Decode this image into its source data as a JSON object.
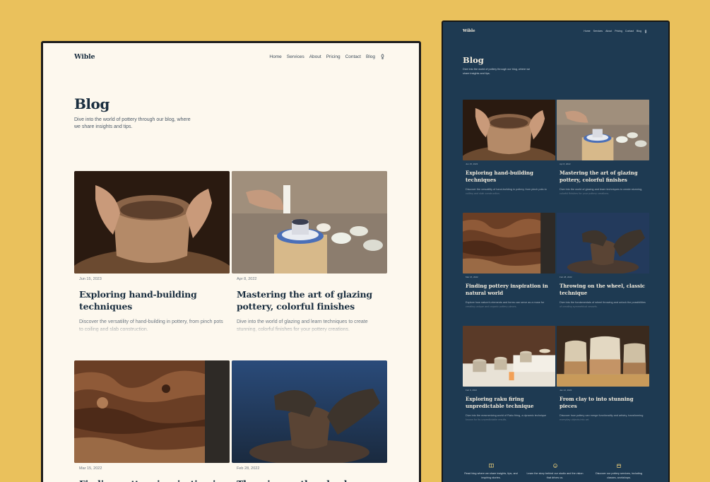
{
  "brand": "Wible",
  "nav": [
    "Home",
    "Services",
    "About",
    "Pricing",
    "Contact",
    "Blog"
  ],
  "hero": {
    "title": "Blog",
    "subtitle": "Dive into the world of pottery through our blog, where we share insights and tips."
  },
  "posts": [
    {
      "date": "Jun 15, 2023",
      "title": "Exploring hand-building techniques",
      "excerpt": "Discover the versatility of hand-building in pottery, from pinch pots to coiling and slab construction.",
      "image": "hands-shaping-pot"
    },
    {
      "date": "Apr 8, 2022",
      "title": "Mastering the art of glazing pottery, colorful finishes",
      "excerpt": "Dive into the world of glazing and learn techniques to create stunning, colorful finishes for your pottery creations.",
      "image": "glazing-table"
    },
    {
      "date": "Mar 15, 2022",
      "title": "Finding pottery inspiration in natural world",
      "excerpt": "Explore how nature's elements and forms can serve as a muse for creating unique and organic pottery pieces.",
      "image": "tree-bark"
    },
    {
      "date": "Feb 28, 2022",
      "title": "Throwing on the wheel, classic technique",
      "excerpt": "Dive into the fundamentals of wheel throwing and unlock the possibilities of creating symmetrical vessels.",
      "image": "wheel-throwing"
    },
    {
      "date": "Feb 9, 2022",
      "title": "Exploring raku firing unpredictable technique",
      "excerpt": "Dive into the mesmerizing world of Raku firing, a dynamic technique known for its unpredictable results.",
      "image": "raku-cups"
    },
    {
      "date": "Jan 12, 2022",
      "title": "From clay to into stunning pieces",
      "excerpt": "Discover how pottery can merge functionality and artistry, transforming everyday objects into art.",
      "image": "clay-jars"
    }
  ],
  "footer": [
    {
      "icon": "book-icon",
      "text": "Read blog where we share insights, tips, and inspiring stories."
    },
    {
      "icon": "smile-icon",
      "text": "Learn the story behind our studio and the vision that drives us."
    },
    {
      "icon": "box-icon",
      "text": "Discover our pottery services, including classes, workshops."
    }
  ],
  "colors": {
    "background": "#eac15c",
    "light_bg": "#fdf8ee",
    "dark_bg": "#1e3a52",
    "heading": "#1a2e3f"
  }
}
